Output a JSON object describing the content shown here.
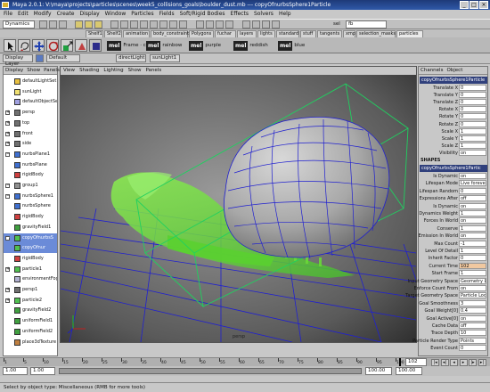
{
  "window": {
    "title": "Maya 2.0.1: V:\\maya\\projects\\particles\\scenes\\week5_collisions_goals\\boulder_dust.mb   ---   copyOfnurbsSphere1Particle",
    "controls": [
      "_",
      "□",
      "×"
    ]
  },
  "menubar": [
    "File",
    "Edit",
    "Modify",
    "Create",
    "Display",
    "Window",
    "Particles",
    "Fields",
    "Soft/Rigid Bodies",
    "Effects",
    "Solvers",
    "Help"
  ],
  "statusline": {
    "mode": "Dynamics",
    "sel_label": "sel",
    "sel_value": "fb"
  },
  "shelf_tabs": [
    "Shelf1",
    "Shelf2",
    "animation",
    "body_constraint",
    "Polygons",
    "fuchar",
    "layers",
    "lights",
    "standard",
    "stuff",
    "tangents",
    "xmp",
    "selection_masks",
    "particles"
  ],
  "shelf_active": "particles",
  "mel_buttons": [
    {
      "label": "mel",
      "text": "Frame · cp"
    },
    {
      "label": "mel",
      "text": "rainbow"
    },
    {
      "label": "mel",
      "text": "purple"
    },
    {
      "label": "mel",
      "text": "reddish"
    },
    {
      "label": "mel",
      "text": "blue"
    }
  ],
  "toolbox": {
    "layer_menu": "Display Layer",
    "layer_value": "Default",
    "light1": "directLight",
    "light2": "sunLight1"
  },
  "outliner": {
    "menus": [
      "Display",
      "Show",
      "Panels"
    ],
    "items": [
      {
        "label": "defaultLightSet",
        "icon": "light-set-icon",
        "exp": "",
        "sel": false
      },
      {
        "label": "sunLight",
        "icon": "light-icon",
        "exp": "",
        "sel": false
      },
      {
        "label": "defaultObjectSet",
        "icon": "object-set-icon",
        "exp": "",
        "sel": false
      },
      {
        "label": "persp",
        "icon": "camera-icon",
        "exp": "+",
        "sel": false
      },
      {
        "label": "top",
        "icon": "camera-icon",
        "exp": "+",
        "sel": false
      },
      {
        "label": "front",
        "icon": "camera-icon",
        "exp": "+",
        "sel": false
      },
      {
        "label": "side",
        "icon": "camera-icon",
        "exp": "+",
        "sel": false
      },
      {
        "label": "nurbsPlane1",
        "icon": "nurbs-icon",
        "exp": "−",
        "sel": false
      },
      {
        "label": "nurbsPlane",
        "icon": "nurbs-icon",
        "exp": "",
        "sel": false
      },
      {
        "label": "rigidBody",
        "icon": "rigid-icon",
        "exp": "",
        "sel": false
      },
      {
        "label": "group1",
        "icon": "group-icon",
        "exp": "−",
        "sel": false
      },
      {
        "label": "nurbsSphere1",
        "icon": "nurbs-icon",
        "exp": "−",
        "sel": false
      },
      {
        "label": "nurbsSphere",
        "icon": "nurbs-icon",
        "exp": "",
        "sel": false
      },
      {
        "label": "rigidBody",
        "icon": "rigid-icon",
        "exp": "",
        "sel": false
      },
      {
        "label": "gravityField1",
        "icon": "field-icon",
        "exp": "",
        "sel": false
      },
      {
        "label": "copyOfnurbsS",
        "icon": "particle-icon",
        "exp": "−",
        "sel": true
      },
      {
        "label": "copyOfnur",
        "icon": "particle-icon",
        "exp": "",
        "sel": true
      },
      {
        "label": "rigidBody",
        "icon": "rigid-icon",
        "exp": "",
        "sel": false
      },
      {
        "label": "particle1",
        "icon": "particle-icon",
        "exp": "+",
        "sel": false
      },
      {
        "label": "environmentFog",
        "icon": "fog-icon",
        "exp": "",
        "sel": false
      },
      {
        "label": "persp1",
        "icon": "camera-icon",
        "exp": "+",
        "sel": false
      },
      {
        "label": "particle2",
        "icon": "particle-icon",
        "exp": "+",
        "sel": false
      },
      {
        "label": "gravityField2",
        "icon": "field-icon",
        "exp": "",
        "sel": false
      },
      {
        "label": "uniformField1",
        "icon": "field-icon",
        "exp": "",
        "sel": false
      },
      {
        "label": "uniformField2",
        "icon": "field-icon",
        "exp": "",
        "sel": false
      },
      {
        "label": "place3dTexture",
        "icon": "texture-icon",
        "exp": "",
        "sel": false
      }
    ]
  },
  "viewport": {
    "menus": [
      "View",
      "Shading",
      "Lighting",
      "Show",
      "Panels"
    ],
    "camera_label": "persp"
  },
  "channelbox": {
    "menus": [
      "Channels",
      "Object"
    ],
    "node_title": "copyOfnurbsSphere1Particle",
    "transform_rows": [
      {
        "label": "Translate X",
        "value": "0"
      },
      {
        "label": "Translate Y",
        "value": "0"
      },
      {
        "label": "Translate Z",
        "value": "0"
      },
      {
        "label": "Rotate X",
        "value": "0"
      },
      {
        "label": "Rotate Y",
        "value": "0"
      },
      {
        "label": "Rotate Z",
        "value": "0"
      },
      {
        "label": "Scale X",
        "value": "1"
      },
      {
        "label": "Scale Y",
        "value": "1"
      },
      {
        "label": "Scale Z",
        "value": "1"
      },
      {
        "label": "Visibility",
        "value": "on"
      }
    ],
    "shapes_label": "SHAPES",
    "shape_title": "copyOfnurbsSphere1Partic",
    "shape_rows": [
      {
        "label": "Is Dynamic",
        "value": "on",
        "hl": false
      },
      {
        "label": "Lifespan Mode",
        "value": "Live forever",
        "hl": false
      },
      {
        "label": "Lifespan Random",
        "value": "0",
        "hl": false
      },
      {
        "label": "Expressions After",
        "value": "off",
        "hl": false
      },
      {
        "label": "Is Dynamic",
        "value": "on",
        "hl": false
      },
      {
        "label": "Dynamics Weight",
        "value": "1",
        "hl": false
      },
      {
        "label": "Forces In World",
        "value": "on",
        "hl": false
      },
      {
        "label": "Conserve",
        "value": "1",
        "hl": false
      },
      {
        "label": "Emission In World",
        "value": "on",
        "hl": false
      },
      {
        "label": "Max Count",
        "value": "-1",
        "hl": false
      },
      {
        "label": "Level Of Detail",
        "value": "1",
        "hl": false
      },
      {
        "label": "Inherit Factor",
        "value": "0",
        "hl": false
      },
      {
        "label": "Current Time",
        "value": "102",
        "hl": true
      },
      {
        "label": "Start Frame",
        "value": "1",
        "hl": false
      },
      {
        "label": "Input Geometry Space",
        "value": "Geometry Lo",
        "hl": false
      },
      {
        "label": "Enforce Count From",
        "value": "on",
        "hl": false
      },
      {
        "label": "Target Geometry Space",
        "value": "Particle Loca",
        "hl": false
      },
      {
        "label": "Goal Smoothness",
        "value": "3",
        "hl": false
      },
      {
        "label": "Goal Weight[0]",
        "value": "0.4",
        "hl": false
      },
      {
        "label": "Goal Active[0]",
        "value": "on",
        "hl": false
      },
      {
        "label": "Cache Data",
        "value": "off",
        "hl": false
      },
      {
        "label": "Trace Depth",
        "value": "10",
        "hl": false
      },
      {
        "label": "Particle Render Type",
        "value": "Points",
        "hl": false
      },
      {
        "label": "Event Count",
        "value": "0",
        "hl": false
      }
    ]
  },
  "timeslider": {
    "ticks": [
      "1",
      "5",
      "10",
      "15",
      "20",
      "25",
      "30",
      "35",
      "40",
      "45",
      "50",
      "55",
      "60",
      "65",
      "70",
      "75",
      "80",
      "85",
      "90",
      "95",
      "100"
    ],
    "current": "102"
  },
  "rangeslider": {
    "start": "1.00",
    "playback_start": "1.00",
    "playback_end": "100.00",
    "end": "100.00"
  },
  "helpline": "Select by object type: Miscellaneous (RMB for more tools)",
  "colors": {
    "particle_green": "#7be040",
    "wire_blue": "#2020d0",
    "bbox_green": "#20d060",
    "viewport_bg": "#8a8a8a",
    "title_blue": "#2f59a8"
  }
}
